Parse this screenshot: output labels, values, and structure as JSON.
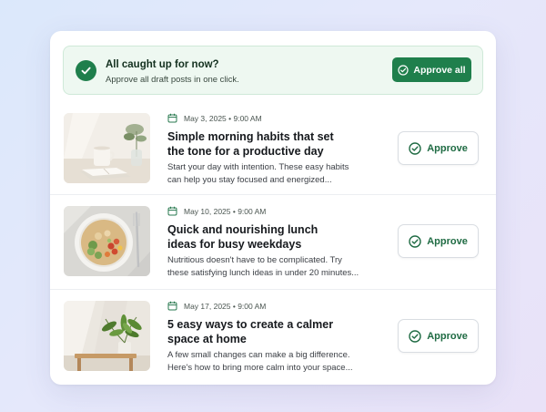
{
  "banner": {
    "title": "All caught up for now?",
    "subtitle": "Approve all draft posts in one click.",
    "approve_all_label": "Approve all",
    "icon": "check-circle-icon"
  },
  "colors": {
    "accent": "#1f7f4c",
    "banner_bg": "#eef8f1",
    "approve_text": "#1f6b43"
  },
  "posts": [
    {
      "date": "May 3, 2025 • 9:00 AM",
      "title": "Simple morning habits that set the tone for a productive day",
      "excerpt": "Start your day with intention. These easy habits can help you stay focused and energized...",
      "image": "coffee-mug-book-plant",
      "approve_label": "Approve"
    },
    {
      "date": "May 10, 2025 • 9:00 AM",
      "title": "Quick and nourishing lunch ideas for busy weekdays",
      "excerpt": "Nutritious doesn't have to be complicated. Try these satisfying lunch ideas in under 20 minutes...",
      "image": "quinoa-salad-bowl",
      "approve_label": "Approve"
    },
    {
      "date": "May 17, 2025 • 9:00 AM",
      "title": "5 easy ways to create a calmer space at home",
      "excerpt": "A few small changes can make a big difference. Here's how to bring more calm into your space...",
      "image": "potted-plant-on-table",
      "approve_label": "Approve"
    }
  ]
}
